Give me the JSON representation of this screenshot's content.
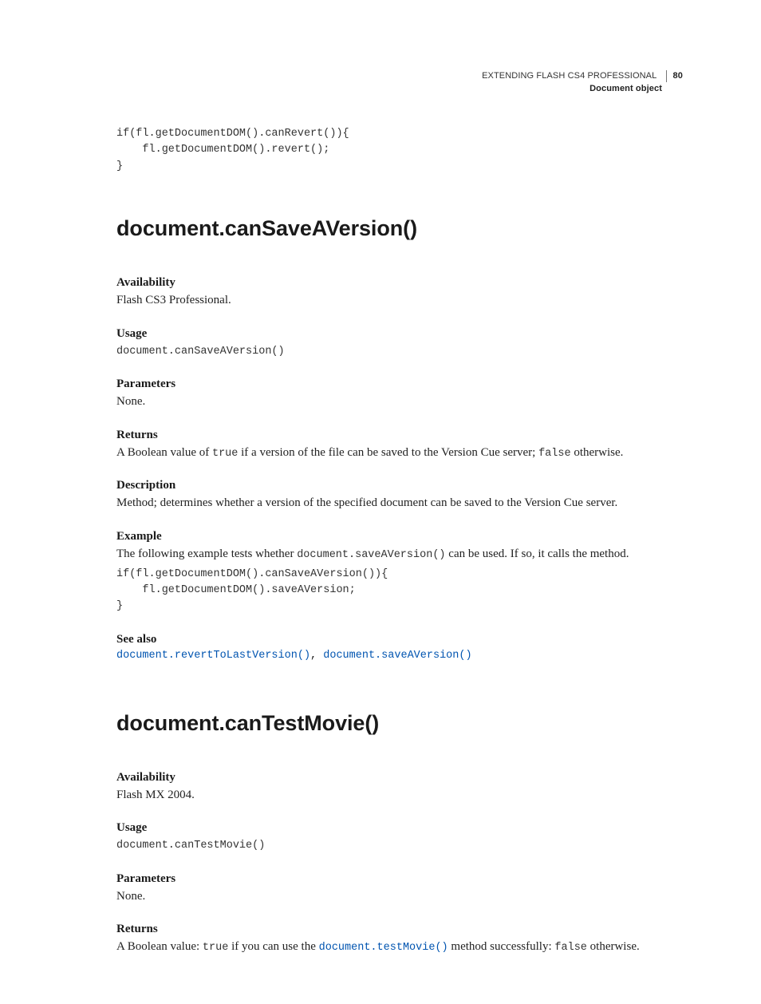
{
  "header": {
    "book": "EXTENDING FLASH CS4 PROFESSIONAL",
    "section_label": "Document object",
    "page_number": "80"
  },
  "intro_code": "if(fl.getDocumentDOM().canRevert()){\n    fl.getDocumentDOM().revert();\n}",
  "sections": [
    {
      "title": "document.canSaveAVersion()",
      "availability": {
        "label": "Availability",
        "text": "Flash CS3 Professional."
      },
      "usage": {
        "label": "Usage",
        "code": "document.canSaveAVersion()"
      },
      "parameters": {
        "label": "Parameters",
        "text": "None."
      },
      "returns": {
        "label": "Returns",
        "prefix": "A Boolean value of ",
        "code1": "true",
        "mid": " if a version of the file can be saved to the Version Cue server; ",
        "code2": "false",
        "suffix": " otherwise."
      },
      "description": {
        "label": "Description",
        "text": "Method; determines whether a version of the specified document can be saved to the Version Cue server."
      },
      "example": {
        "label": "Example",
        "intro_prefix": "The following example tests whether ",
        "intro_code": "document.saveAVersion()",
        "intro_suffix": " can be used. If so, it calls the method.",
        "code": "if(fl.getDocumentDOM().canSaveAVersion()){\n    fl.getDocumentDOM().saveAVersion;\n}"
      },
      "seealso": {
        "label": "See also",
        "links": [
          "document.revertToLastVersion()",
          "document.saveAVersion()"
        ],
        "separator": ", "
      }
    },
    {
      "title": "document.canTestMovie()",
      "availability": {
        "label": "Availability",
        "text": "Flash MX 2004."
      },
      "usage": {
        "label": "Usage",
        "code": "document.canTestMovie()"
      },
      "parameters": {
        "label": "Parameters",
        "text": "None."
      },
      "returns": {
        "label": "Returns",
        "prefix": "A Boolean value: ",
        "code1": "true",
        "mid": " if you can use the ",
        "link": "document.testMovie()",
        "mid2": " method successfully: ",
        "code2": "false",
        "suffix": " otherwise."
      }
    }
  ]
}
